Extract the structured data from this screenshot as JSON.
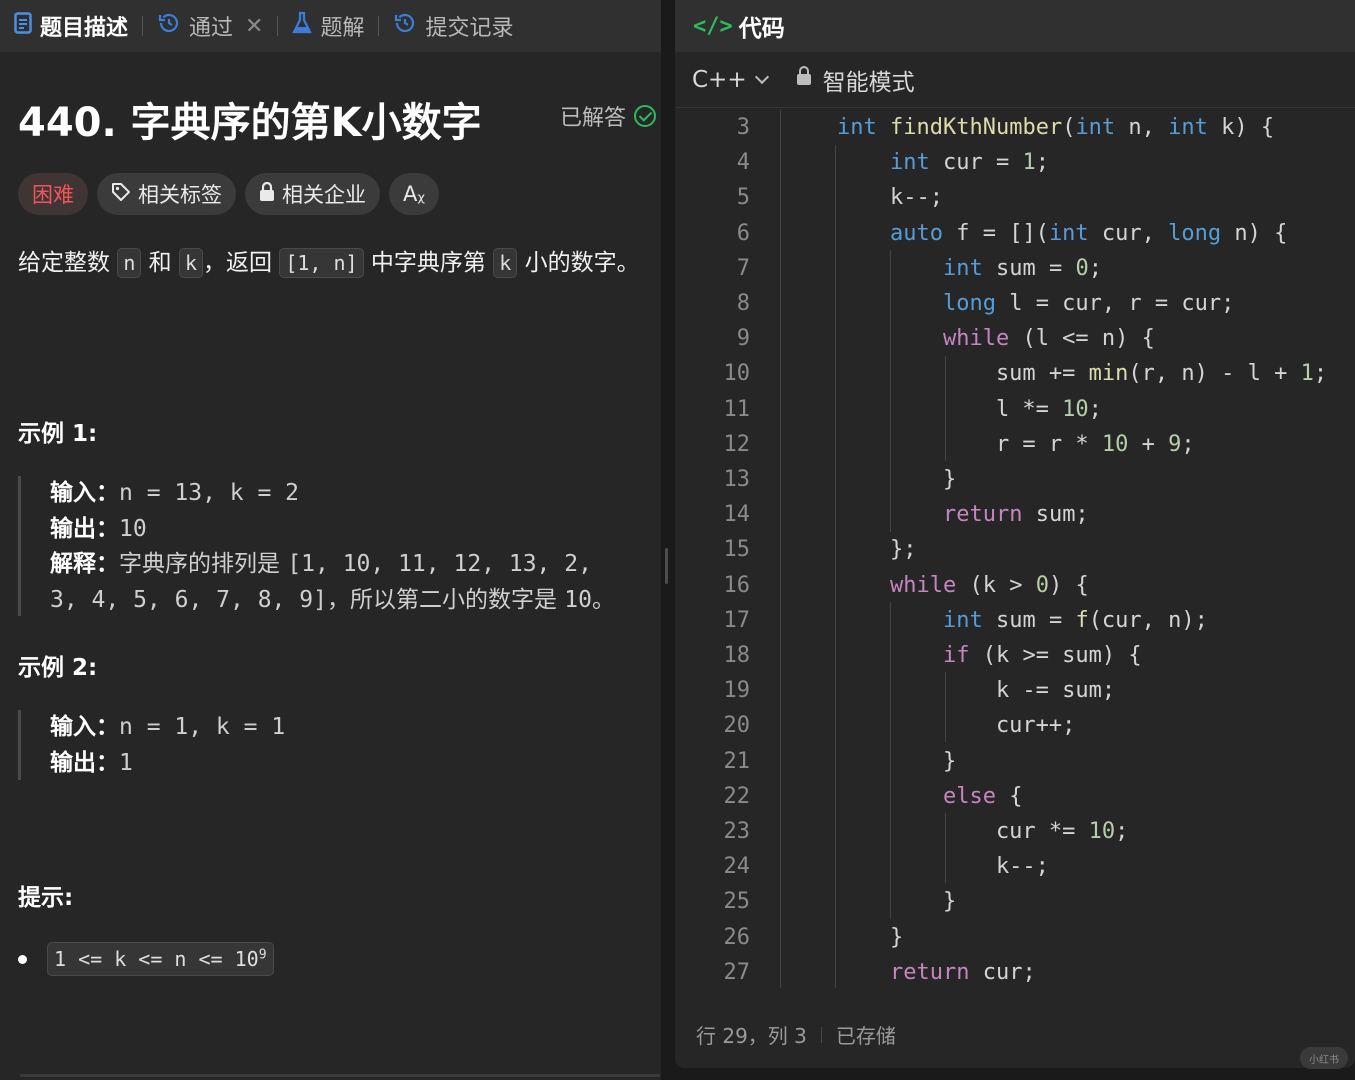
{
  "left_tabs": {
    "description": "题目描述",
    "pass": "通过",
    "solutions": "题解",
    "submissions": "提交记录"
  },
  "problem": {
    "title": "440. 字典序的第K小数字",
    "status": "已解答",
    "difficulty": "困难",
    "tags_label": "相关标签",
    "companies_label": "相关企业",
    "font_button": "Aᵪ",
    "desc": {
      "p1": "给定整数 ",
      "n": "n",
      "p2": " 和 ",
      "k": "k",
      "p3": "，返回 ",
      "range": "[1, n]",
      "p4": " 中字典序第 ",
      "k2": "k",
      "p5": " 小的数字。"
    }
  },
  "examples": [
    {
      "title": "示例 1:",
      "input_label": "输入：",
      "input": "n = 13, k = 2",
      "output_label": "输出：",
      "output": "10",
      "explain_label": "解释：",
      "explain_a": "字典序的排列是 ",
      "explain_b": "[1, 10, 11, 12, 13, 2,",
      "explain_c": "3, 4, 5, 6, 7, 8, 9]",
      "explain_d": "，所以第二小的数字是 ",
      "explain_e": "10",
      "explain_f": "。"
    },
    {
      "title": "示例 2:",
      "input_label": "输入：",
      "input": "n = 1, k = 1",
      "output_label": "输出：",
      "output": "1"
    }
  ],
  "hints": {
    "title": "提示:",
    "constraint": "1 <= k <= n <= 10",
    "constraint_exp": "9"
  },
  "editor": {
    "header": "代码",
    "language": "C++",
    "mode": "智能模式",
    "status_pos": "行 29，列 3",
    "status_saved": "已存储"
  },
  "code_lines": [
    {
      "n": "3",
      "t": [
        [
          "kw",
          "int"
        ],
        [
          "pl",
          " "
        ],
        [
          "fn",
          "findKthNumber"
        ],
        [
          "pl",
          "("
        ],
        [
          "kw",
          "int"
        ],
        [
          "pl",
          " n, "
        ],
        [
          "kw",
          "int"
        ],
        [
          "pl",
          " k) {"
        ]
      ]
    },
    {
      "n": "4",
      "t": [
        [
          "pl",
          "    "
        ],
        [
          "kw",
          "int"
        ],
        [
          "pl",
          " cur = "
        ],
        [
          "num",
          "1"
        ],
        [
          "pl",
          ";"
        ]
      ]
    },
    {
      "n": "5",
      "t": [
        [
          "pl",
          "    k--;"
        ]
      ]
    },
    {
      "n": "6",
      "t": [
        [
          "pl",
          "    "
        ],
        [
          "kw",
          "auto"
        ],
        [
          "pl",
          " f = []("
        ],
        [
          "kw",
          "int"
        ],
        [
          "pl",
          " cur, "
        ],
        [
          "kw",
          "long"
        ],
        [
          "pl",
          " n) {"
        ]
      ]
    },
    {
      "n": "7",
      "t": [
        [
          "pl",
          "        "
        ],
        [
          "kw",
          "int"
        ],
        [
          "pl",
          " sum = "
        ],
        [
          "num",
          "0"
        ],
        [
          "pl",
          ";"
        ]
      ]
    },
    {
      "n": "8",
      "t": [
        [
          "pl",
          "        "
        ],
        [
          "kw",
          "long"
        ],
        [
          "pl",
          " l = cur, r = cur;"
        ]
      ]
    },
    {
      "n": "9",
      "t": [
        [
          "pl",
          "        "
        ],
        [
          "ctl",
          "while"
        ],
        [
          "pl",
          " (l <= n) {"
        ]
      ]
    },
    {
      "n": "10",
      "t": [
        [
          "pl",
          "            sum += "
        ],
        [
          "fn",
          "min"
        ],
        [
          "pl",
          "(r, n) - l + "
        ],
        [
          "num",
          "1"
        ],
        [
          "pl",
          ";"
        ]
      ]
    },
    {
      "n": "11",
      "t": [
        [
          "pl",
          "            l *= "
        ],
        [
          "num",
          "10"
        ],
        [
          "pl",
          ";"
        ]
      ]
    },
    {
      "n": "12",
      "t": [
        [
          "pl",
          "            r = r * "
        ],
        [
          "num",
          "10"
        ],
        [
          "pl",
          " + "
        ],
        [
          "num",
          "9"
        ],
        [
          "pl",
          ";"
        ]
      ]
    },
    {
      "n": "13",
      "t": [
        [
          "pl",
          "        }"
        ]
      ]
    },
    {
      "n": "14",
      "t": [
        [
          "pl",
          "        "
        ],
        [
          "ctl",
          "return"
        ],
        [
          "pl",
          " sum;"
        ]
      ]
    },
    {
      "n": "15",
      "t": [
        [
          "pl",
          "    };"
        ]
      ]
    },
    {
      "n": "16",
      "t": [
        [
          "pl",
          "    "
        ],
        [
          "ctl",
          "while"
        ],
        [
          "pl",
          " (k > "
        ],
        [
          "num",
          "0"
        ],
        [
          "pl",
          ") {"
        ]
      ]
    },
    {
      "n": "17",
      "t": [
        [
          "pl",
          "        "
        ],
        [
          "kw",
          "int"
        ],
        [
          "pl",
          " sum = "
        ],
        [
          "fn",
          "f"
        ],
        [
          "pl",
          "(cur, n);"
        ]
      ]
    },
    {
      "n": "18",
      "t": [
        [
          "pl",
          "        "
        ],
        [
          "ctl",
          "if"
        ],
        [
          "pl",
          " (k >= sum) {"
        ]
      ]
    },
    {
      "n": "19",
      "t": [
        [
          "pl",
          "            k -= sum;"
        ]
      ]
    },
    {
      "n": "20",
      "t": [
        [
          "pl",
          "            cur++;"
        ]
      ]
    },
    {
      "n": "21",
      "t": [
        [
          "pl",
          "        }"
        ]
      ]
    },
    {
      "n": "22",
      "t": [
        [
          "pl",
          "        "
        ],
        [
          "ctl",
          "else"
        ],
        [
          "pl",
          " {"
        ]
      ]
    },
    {
      "n": "23",
      "t": [
        [
          "pl",
          "            cur *= "
        ],
        [
          "num",
          "10"
        ],
        [
          "pl",
          ";"
        ]
      ]
    },
    {
      "n": "24",
      "t": [
        [
          "pl",
          "            k--;"
        ]
      ]
    },
    {
      "n": "25",
      "t": [
        [
          "pl",
          "        }"
        ]
      ]
    },
    {
      "n": "26",
      "t": [
        [
          "pl",
          "    }"
        ]
      ]
    },
    {
      "n": "27",
      "t": [
        [
          "pl",
          "    "
        ],
        [
          "ctl",
          "return"
        ],
        [
          "pl",
          " cur;"
        ]
      ]
    }
  ],
  "watermark": "小红书"
}
